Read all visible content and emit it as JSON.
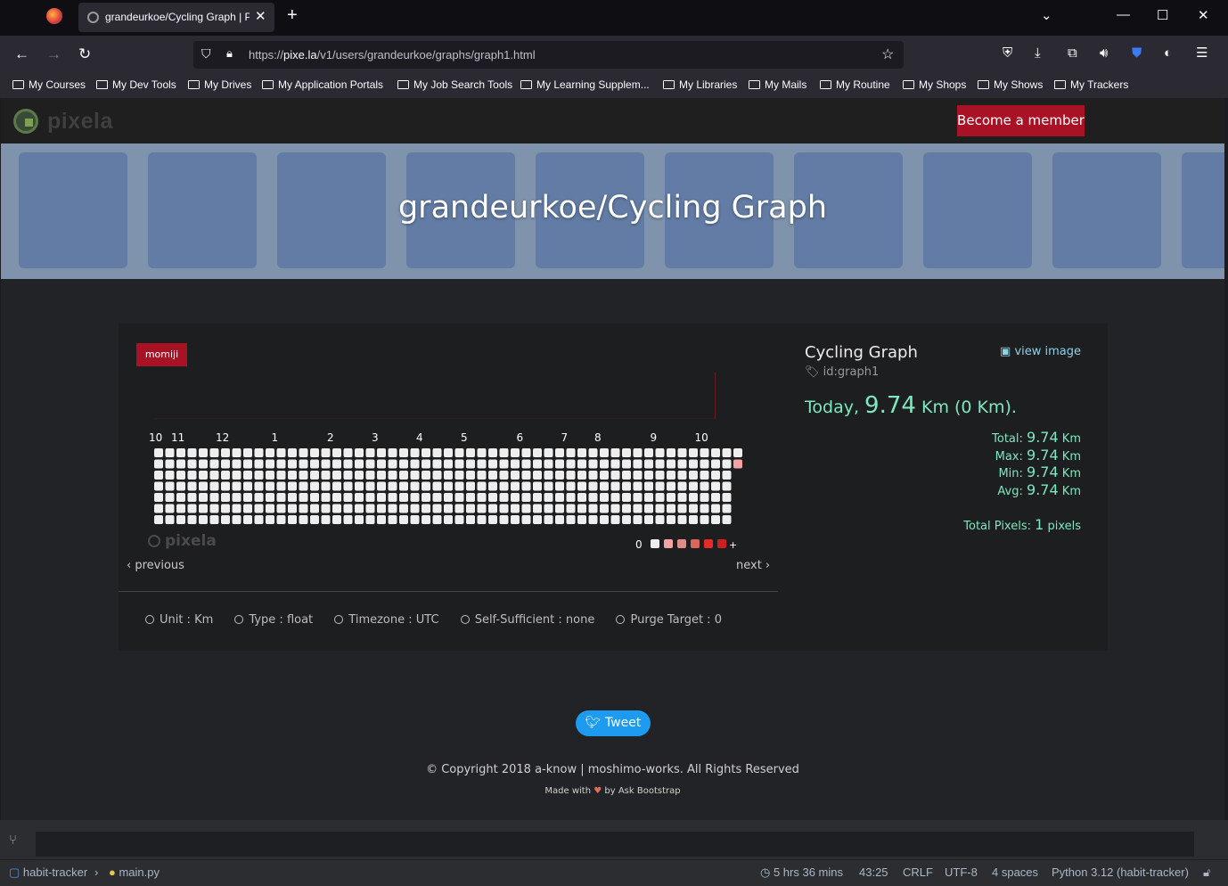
{
  "browser": {
    "tab_title": "grandeurkoe/Cycling Graph | Pi",
    "url_prefix": "https://",
    "url_host": "pixe.la",
    "url_path": "/v1/users/grandeurkoe/graphs/graph1.html"
  },
  "bookmarks": [
    "My Courses",
    "My Dev Tools",
    "My Drives",
    "My Application Portals",
    "My Job Search Tools",
    "My Learning Supplem...",
    "My Libraries",
    "My Mails",
    "My Routine",
    "My Shops",
    "My Shows",
    "My Trackers"
  ],
  "site": {
    "logo_text": "pixela",
    "member_button": "Become a member",
    "hero_title": "grandeurkoe/Cycling Graph"
  },
  "graph": {
    "theme": "momiji",
    "months": [
      "10",
      "11",
      "12",
      "1",
      "2",
      "3",
      "4",
      "5",
      "6",
      "7",
      "8",
      "9",
      "10"
    ],
    "legend_zero": "0",
    "legend_plus": "+",
    "watermark": "pixela",
    "previous": "‹ previous",
    "next": "next ›",
    "colors": {
      "empty": "#eeeeee",
      "level1": "#f4a3a3",
      "level2": "#e08a8a",
      "level3": "#d9665a",
      "level4": "#e62a2a",
      "level5": "#cf1e1e"
    },
    "pixels": [
      {
        "value": 9.74,
        "level": 1
      }
    ]
  },
  "meta": {
    "unit": "Unit : Km",
    "type": "Type : float",
    "timezone": "Timezone : UTC",
    "self_sufficient": "Self-Sufficient : none",
    "purge_target": "Purge Target : 0"
  },
  "info": {
    "name": "Cycling Graph",
    "view_image": "view image",
    "id": "id:graph1",
    "today_label": "Today,",
    "today_value": "9.74",
    "today_unit": "Km (0 Km).",
    "total_label": "Total:",
    "total_value": "9.74",
    "max_label": "Max:",
    "max_value": "9.74",
    "min_label": "Min:",
    "min_value": "9.74",
    "avg_label": "Avg:",
    "avg_value": "9.74",
    "unit": "Km",
    "pixels_label": "Total Pixels:",
    "pixels_value": "1",
    "pixels_unit": "pixels"
  },
  "footer": {
    "tweet": "Tweet",
    "copyright": "© Copyright 2018 a-know | moshimo-works. All Rights Reserved",
    "made_with": "Made with",
    "heart": "♥",
    "by": "by Ask Bootstrap"
  },
  "ide": {
    "project": "habit-tracker",
    "file": "main.py",
    "time": "5 hrs 36 mins",
    "position": "43:25",
    "line_ending": "CRLF",
    "encoding": "UTF-8",
    "indent": "4 spaces",
    "interpreter": "Python 3.12 (habit-tracker)"
  }
}
